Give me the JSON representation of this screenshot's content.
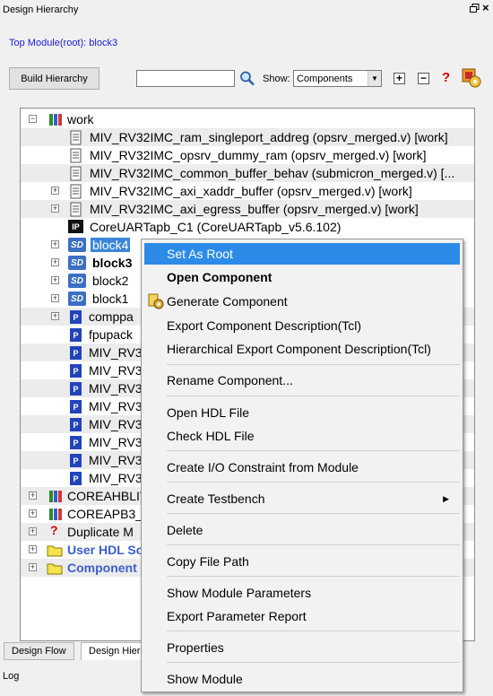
{
  "panel": {
    "title": "Design Hierarchy",
    "top_module": "Top Module(root): block3"
  },
  "toolbar": {
    "build_label": "Build Hierarchy",
    "search_value": "",
    "show_label": "Show:",
    "show_value": "Components",
    "expand_glyph": "+",
    "collapse_glyph": "−",
    "help_glyph": "?"
  },
  "tree": {
    "work": "work",
    "items": [
      "MIV_RV32IMC_ram_singleport_addreg (opsrv_merged.v) [work]",
      "MIV_RV32IMC_opsrv_dummy_ram (opsrv_merged.v) [work]",
      "MIV_RV32IMC_common_buffer_behav (submicron_merged.v) [...",
      "MIV_RV32IMC_axi_xaddr_buffer (opsrv_merged.v) [work]",
      "MIV_RV32IMC_axi_egress_buffer (opsrv_merged.v) [work]",
      "CoreUARTapb_C1 (CoreUARTapb_v5.6.102)",
      "block4",
      "block3",
      "block2",
      "block1",
      "comppa",
      "fpupack",
      "MIV_RV3",
      "MIV_RV3",
      "MIV_RV3",
      "MIV_RV3",
      "MIV_RV3",
      "MIV_RV3",
      "MIV_RV3",
      "MIV_RV3",
      "COREAHBLIT",
      "COREAPB3_I",
      "Duplicate M",
      "User HDL Sc",
      "Component"
    ],
    "ip_badge": "IP",
    "sd_badge": "SD",
    "p_badge": "P"
  },
  "tabs": [
    "Design Flow",
    "Design Hier"
  ],
  "log_label": "Log",
  "context_menu": {
    "items": [
      "Set As Root",
      "Open Component",
      "Generate Component",
      "Export Component Description(Tcl)",
      "Hierarchical Export Component Description(Tcl)",
      "Rename Component...",
      "Open HDL File",
      "Check HDL File",
      "Create I/O Constraint from Module",
      "Create Testbench",
      "Delete",
      "Copy File Path",
      "Show Module Parameters",
      "Export Parameter Report",
      "Properties",
      "Show Module"
    ],
    "submenu_glyph": "▶"
  },
  "colors": {
    "selection": "#3b86d8",
    "menu_highlight": "#2d8be8",
    "link_blue": "#1a1adb"
  }
}
